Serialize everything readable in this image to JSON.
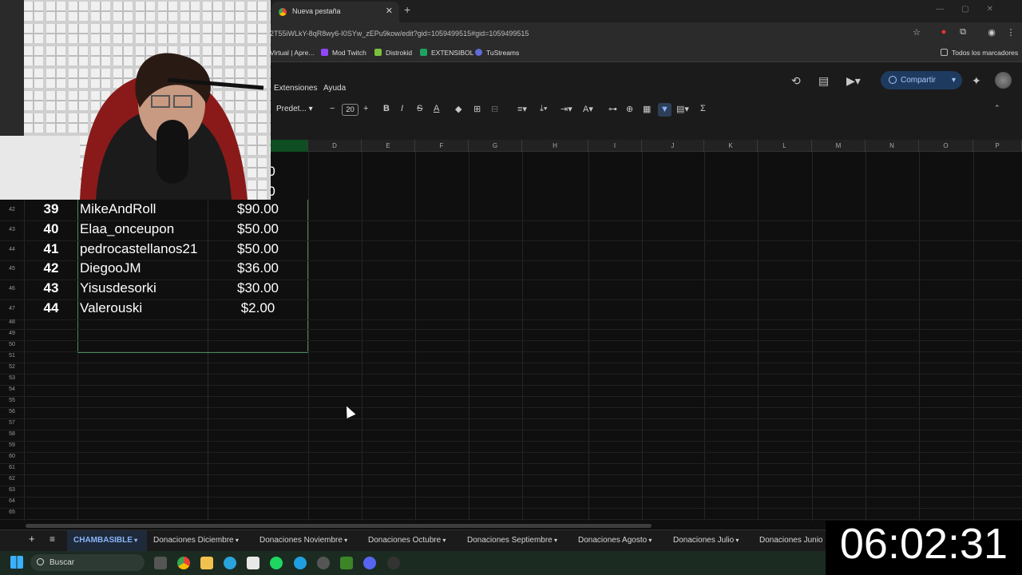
{
  "browser": {
    "tab_title": "Nueva pestaña",
    "url": "2T55iWLkY-8qR8wy6-I0SYw_zEPu9kow/edit?gid=1059499515#gid=1059499515",
    "bookmarks": [
      "Virtual | Apre...",
      "Mod Twitch",
      "Distrokid",
      "EXTENSIBOL",
      "TuStreams"
    ],
    "bookmarks_all": "Todos los marcadores"
  },
  "sheets": {
    "menu": [
      "Extensiones",
      "Ayuda"
    ],
    "share_label": "Compartir",
    "font_name": "Predet...",
    "font_size": "20",
    "columns": [
      "D",
      "E",
      "F",
      "G",
      "H",
      "I",
      "J",
      "K",
      "L",
      "M",
      "N",
      "O",
      "P"
    ],
    "partial_values_top": [
      ".00",
      ".00",
      ".00"
    ],
    "donors": [
      {
        "row": "42",
        "rank": "39",
        "name": "MikeAndRoll",
        "amount": "$90.00"
      },
      {
        "row": "43",
        "rank": "40",
        "name": "Elaa_onceupon",
        "amount": "$50.00"
      },
      {
        "row": "44",
        "rank": "41",
        "name": "pedrocastellanos21",
        "amount": "$50.00"
      },
      {
        "row": "45",
        "rank": "42",
        "name": "DiegooJM",
        "amount": "$36.00"
      },
      {
        "row": "46",
        "rank": "43",
        "name": "Yisusdesorki",
        "amount": "$30.00"
      },
      {
        "row": "47",
        "rank": "44",
        "name": "Valerouski",
        "amount": "$2.00"
      }
    ],
    "empty_rows": [
      "48",
      "49",
      "50",
      "51",
      "52",
      "53",
      "54",
      "55",
      "56",
      "57",
      "58",
      "59",
      "60",
      "61",
      "62",
      "63",
      "64",
      "65"
    ],
    "sheet_tabs": [
      "CHAMBASIBLE",
      "Donaciones Diciembre",
      "Donaciones Noviembre",
      "Donaciones Octubre",
      "Donaciones Septiembre",
      "Donaciones Agosto",
      "Donaciones Julio",
      "Donaciones Junio"
    ]
  },
  "taskbar": {
    "search_placeholder": "Buscar"
  },
  "overlay": {
    "timer": "06:02:31"
  },
  "colors": {
    "accent": "#8ab4f8",
    "selected_col": "#0f4d22",
    "share_bg": "#1f3a5f"
  }
}
